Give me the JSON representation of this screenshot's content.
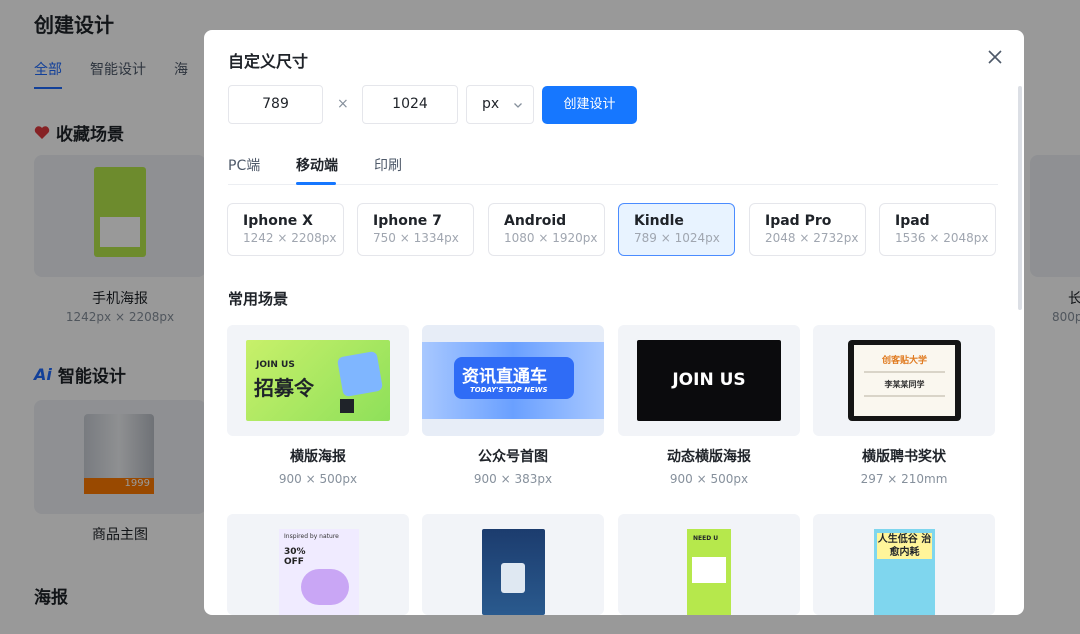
{
  "background": {
    "title": "创建设计",
    "tabs": [
      "全部",
      "智能设计",
      "海"
    ],
    "sections": [
      "收藏场景",
      "智能设计",
      "海报"
    ],
    "cards": [
      {
        "label": "手机海报",
        "sub": "1242px × 2208px"
      },
      {
        "label": "商品主图",
        "sub": ""
      }
    ],
    "right_card": {
      "label": "长",
      "sub": "800p"
    },
    "fridge_price": "1999"
  },
  "modal": {
    "title": "自定义尺寸",
    "width_value": "789",
    "height_value": "1024",
    "times": "×",
    "unit": "px",
    "create_label": "创建设计",
    "tabs": [
      "PC端",
      "移动端",
      "印刷"
    ],
    "active_tab": "移动端",
    "devices": [
      {
        "name": "Iphone X",
        "dim": "1242 × 2208px"
      },
      {
        "name": "Iphone 7",
        "dim": "750 × 1334px"
      },
      {
        "name": "Android",
        "dim": "1080 × 1920px"
      },
      {
        "name": "Kindle",
        "dim": "789 × 1024px"
      },
      {
        "name": "Ipad Pro",
        "dim": "2048 × 2732px"
      },
      {
        "name": "Ipad",
        "dim": "1536 × 2048px"
      }
    ],
    "active_device": "Kindle",
    "scenes_title": "常用场景",
    "scenes": [
      {
        "name": "横版海报",
        "dim": "900 × 500px"
      },
      {
        "name": "公众号首图",
        "dim": "900 × 383px"
      },
      {
        "name": "动态横版海报",
        "dim": "900 × 500px"
      },
      {
        "name": "横版聘书奖状",
        "dim": "297 × 210mm"
      }
    ],
    "thumb_text": {
      "recruit_small": "JOIN US",
      "recruit_big": "招募令",
      "news_big": "资讯直通车",
      "news_small": "TODAY'S TOP NEWS",
      "dynamic": "JOIN US",
      "cert_title": "创客贴大学",
      "cert_sub": "李某某同学",
      "promo_top": "Inspired by nature",
      "promo_discount": "30% OFF",
      "phone_tag": "NEED U",
      "book_title": "人生低谷 治愈内耗"
    }
  },
  "colors": {
    "primary": "#1677ff",
    "active_device_bg": "#e8f3ff"
  }
}
